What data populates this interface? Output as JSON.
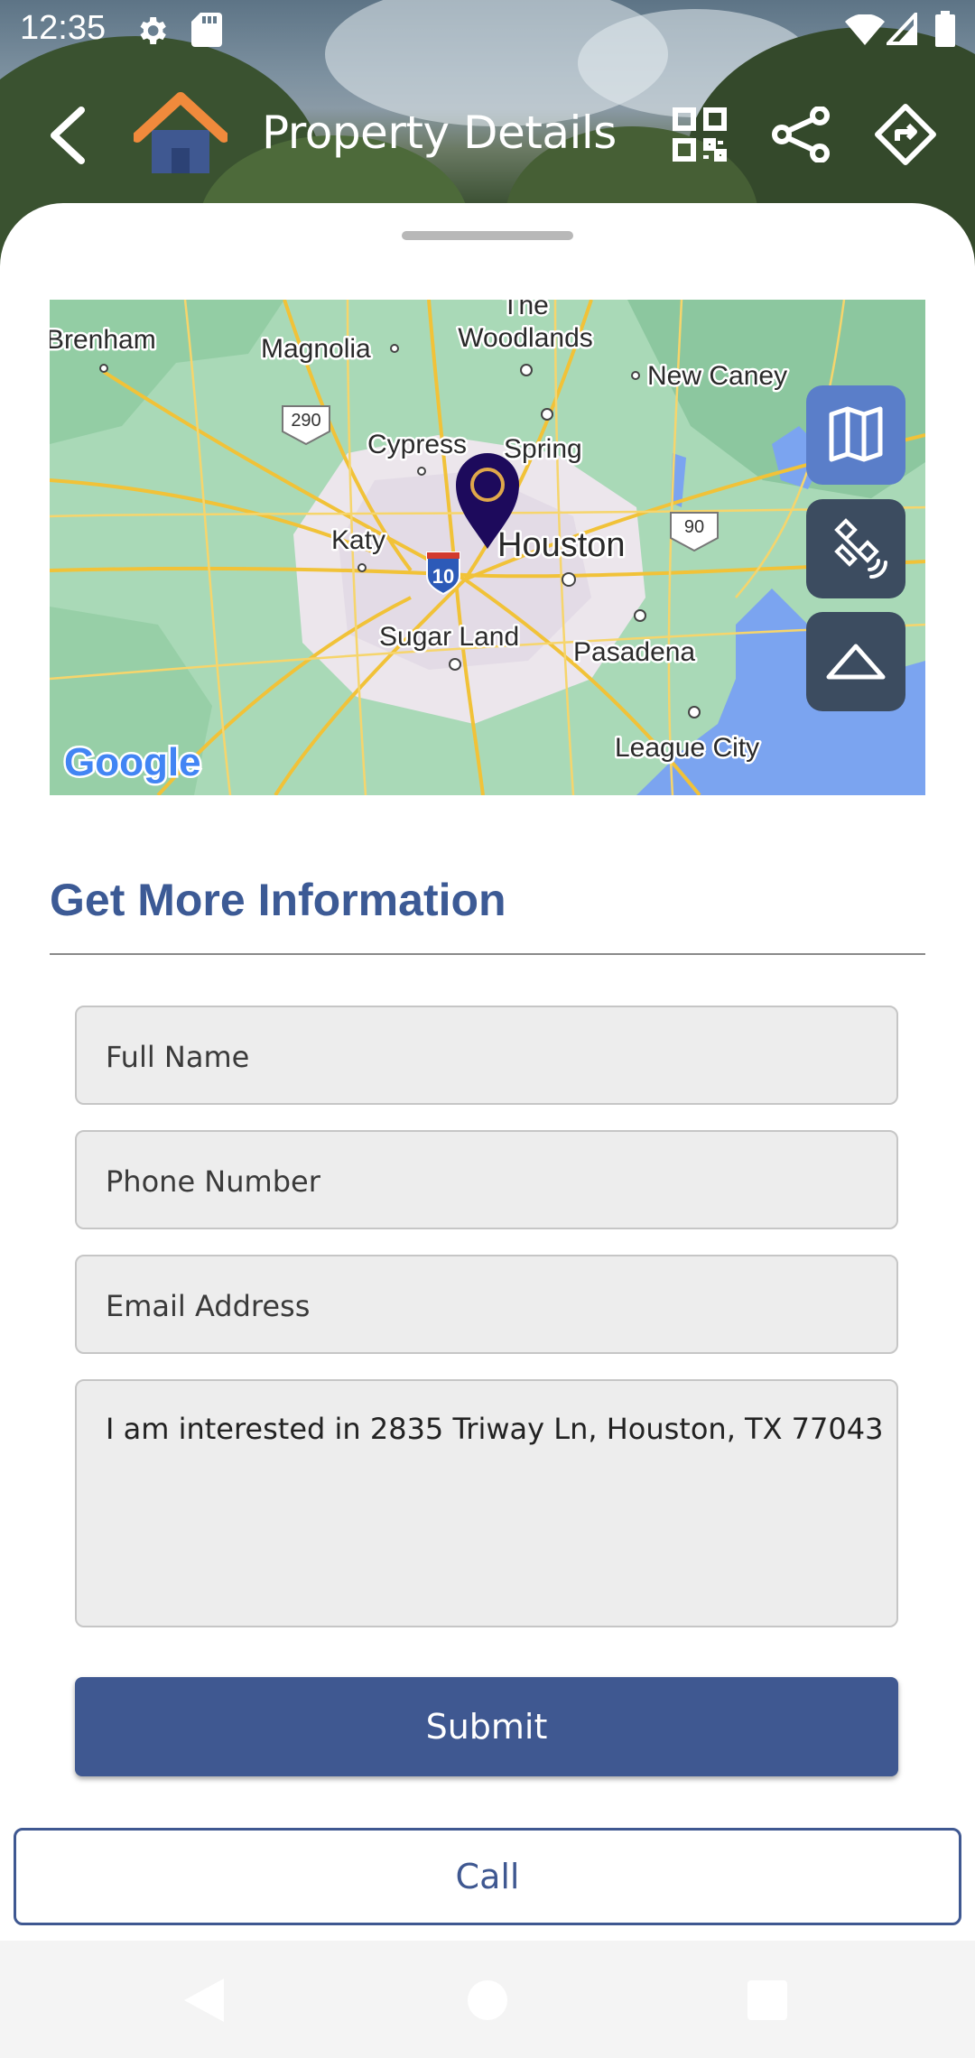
{
  "status_bar": {
    "time": "12:35"
  },
  "app_bar": {
    "title": "Property Details"
  },
  "map": {
    "labels": {
      "the": "The",
      "woodlands": "Woodlands",
      "brenham": "Brenham",
      "magnolia": "Magnolia",
      "new_caney": "New Caney",
      "hwy290": "290",
      "cypress": "Cypress",
      "spring": "Spring",
      "hwy90": "90",
      "katy": "Katy",
      "i10": "10",
      "houston": "Houston",
      "sugar_land": "Sugar Land",
      "pasadena": "Pasadena",
      "league_city": "League City"
    },
    "attribution": "Google"
  },
  "form": {
    "section_title": "Get More Information",
    "full_name_placeholder": "Full Name",
    "phone_placeholder": "Phone Number",
    "email_placeholder": "Email Address",
    "message_value": "I am interested in 2835 Triway Ln, Houston, TX 77043",
    "submit_label": "Submit"
  },
  "actions": {
    "call_label": "Call"
  },
  "colors": {
    "accent": "#3f5891",
    "title_blue": "#3c5a95",
    "house_orange": "#f08a3c",
    "pin": "#1d0a5c"
  }
}
